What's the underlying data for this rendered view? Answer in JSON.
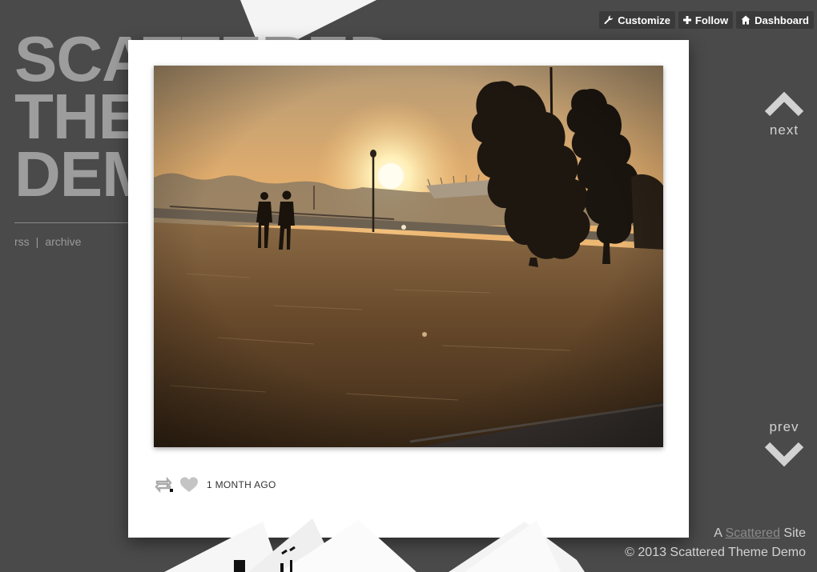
{
  "site": {
    "title_lines": [
      "SCATTERED",
      "THEME",
      "DEMO"
    ],
    "links": [
      {
        "label": "rss"
      },
      {
        "label": "archive"
      }
    ],
    "link_separator": "|"
  },
  "toolbar": {
    "buttons": [
      {
        "label": "Customize",
        "icon": "wrench-icon"
      },
      {
        "label": "Follow",
        "icon": "plus-icon"
      },
      {
        "label": "Dashboard",
        "icon": "home-icon"
      }
    ]
  },
  "nav": {
    "next_label": "next",
    "prev_label": "prev"
  },
  "post": {
    "time_ago": "1 MONTH AGO",
    "reblog_icon": "reblog-icon",
    "like_icon": "heart-icon"
  },
  "footer": {
    "line1_prefix": "A",
    "line1_link": "Scattered",
    "line1_suffix": "Site",
    "copyright": "© 2013 Scattered Theme Demo"
  },
  "colors": {
    "background": "#4a4a4a",
    "card": "#ffffff",
    "title_gray": "#9d9d9d",
    "nav_text": "#d2d2d2"
  }
}
